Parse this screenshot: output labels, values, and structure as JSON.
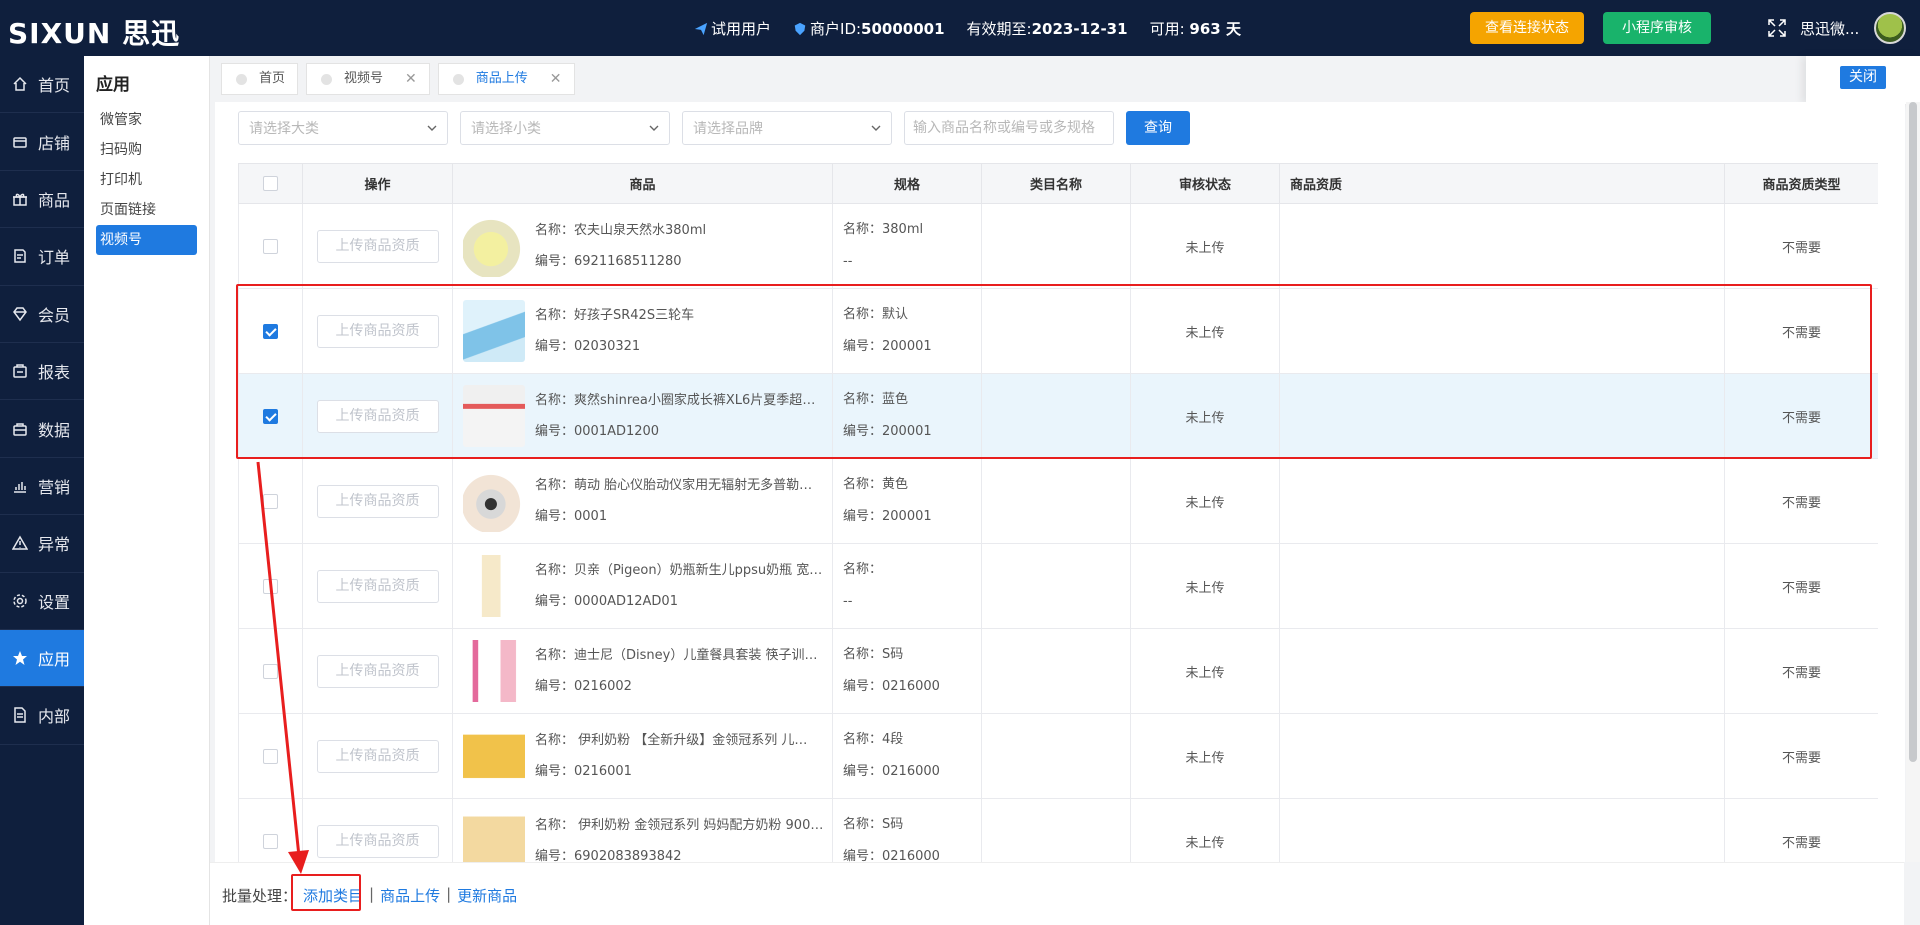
{
  "topbar": {
    "logo_text": "SIXUN",
    "logo_cn": "思迅",
    "trial_user": "试用用户",
    "merchant_label": "商户ID:",
    "merchant_id": "50000001",
    "valid_label": "有效期至:",
    "valid_date": "2023-12-31",
    "available_label": "可用:",
    "available_days": "963 天",
    "btn_status": "查看连接状态",
    "btn_review": "小程序审核",
    "user_name": "思迅微...",
    "icons": [
      "paper-plane-icon",
      "shield-icon",
      "expand-icon"
    ]
  },
  "leftnav": {
    "items": [
      {
        "label": "首页",
        "icon": "home-icon"
      },
      {
        "label": "店铺",
        "icon": "store-icon"
      },
      {
        "label": "商品",
        "icon": "gift-icon"
      },
      {
        "label": "订单",
        "icon": "order-icon"
      },
      {
        "label": "会员",
        "icon": "diamond-icon"
      },
      {
        "label": "报表",
        "icon": "report-icon"
      },
      {
        "label": "数据",
        "icon": "data-icon"
      },
      {
        "label": "营销",
        "icon": "chart-icon"
      },
      {
        "label": "异常",
        "icon": "warning-icon"
      },
      {
        "label": "设置",
        "icon": "gear-icon"
      },
      {
        "label": "应用",
        "icon": "star-icon"
      },
      {
        "label": "内部",
        "icon": "doc-icon"
      }
    ]
  },
  "submenu": {
    "title": "应用",
    "items": [
      "微管家",
      "扫码购",
      "打印机",
      "页面链接",
      "视频号"
    ]
  },
  "tabs": [
    {
      "label": "首页"
    },
    {
      "label": "视频号"
    },
    {
      "label": "商品上传"
    }
  ],
  "close_label": "关闭",
  "filters": {
    "category_placeholder": "请选择大类",
    "subcategory_placeholder": "请选择小类",
    "brand_placeholder": "请选择品牌",
    "search_placeholder": "输入商品名称或编号或多规格",
    "query_label": "查询"
  },
  "table": {
    "headers": [
      "",
      "操作",
      "商品",
      "规格",
      "类目名称",
      "审核状态",
      "商品资质",
      "商品资质类型"
    ],
    "upload_btn_label": "上传商品资质",
    "rows": [
      {
        "checked": false,
        "name": "名称：农夫山泉天然水380ml",
        "code": "编号：6921168511280",
        "spec1": "名称：380ml",
        "spec2": "--",
        "category": "",
        "status": "未上传",
        "qual": "",
        "qual_type": "不需要"
      },
      {
        "checked": true,
        "name": "名称：好孩子SR42S三轮车",
        "code": "编号：02030321",
        "spec1": "名称：默认",
        "spec2": "编号：200001",
        "category": "",
        "status": "未上传",
        "qual": "",
        "qual_type": "不需要"
      },
      {
        "checked": true,
        "name": "名称：爽然shinrea小圈家成长裤XL6片夏季超薄…",
        "code": "编号：0001AD1200",
        "spec1": "名称：蓝色",
        "spec2": "编号：200001",
        "category": "",
        "status": "未上传",
        "qual": "",
        "qual_type": "不需要"
      },
      {
        "checked": false,
        "name": "名称：萌动 胎心仪胎动仪家用无辐射无多普勒…",
        "code": "编号：0001",
        "spec1": "名称：黄色",
        "spec2": "编号：200001",
        "category": "",
        "status": "未上传",
        "qual": "",
        "qual_type": "不需要"
      },
      {
        "checked": false,
        "name": "名称：贝亲（Pigeon）奶瓶新生儿ppsu奶瓶 宽…",
        "code": "编号：0000AD12AD01",
        "spec1": "名称：",
        "spec2": "--",
        "category": "",
        "status": "未上传",
        "qual": "",
        "qual_type": "不需要"
      },
      {
        "checked": false,
        "name": "名称：迪士尼（Disney）儿童餐具套装 筷子训…",
        "code": "编号：0216002",
        "spec1": "名称：S码",
        "spec2": "编号：0216000",
        "category": "",
        "status": "未上传",
        "qual": "",
        "qual_type": "不需要"
      },
      {
        "checked": false,
        "name": "名称： 伊利奶粉 【全新升级】金领冠系列 儿…",
        "code": "编号：0216001",
        "spec1": "名称：4段",
        "spec2": "编号：0216000",
        "category": "",
        "status": "未上传",
        "qual": "",
        "qual_type": "不需要"
      },
      {
        "checked": false,
        "name": "名称： 伊利奶粉 金领冠系列 妈妈配方奶粉 900…",
        "code": "编号：6902083893842",
        "spec1": "名称：S码",
        "spec2": "编号：0216000",
        "category": "",
        "status": "未上传",
        "qual": "",
        "qual_type": "不需要"
      }
    ]
  },
  "bottombar": {
    "batch_label": "批量处理：",
    "actions": [
      "添加类目",
      "商品上传",
      "更新商品"
    ],
    "sep": "|"
  },
  "colors": {
    "topbar_bg": "#0f1f3d",
    "accent": "#1f7ae0",
    "orange": "#f5a400",
    "green": "#19b36b",
    "annotation": "#e81e1e"
  }
}
